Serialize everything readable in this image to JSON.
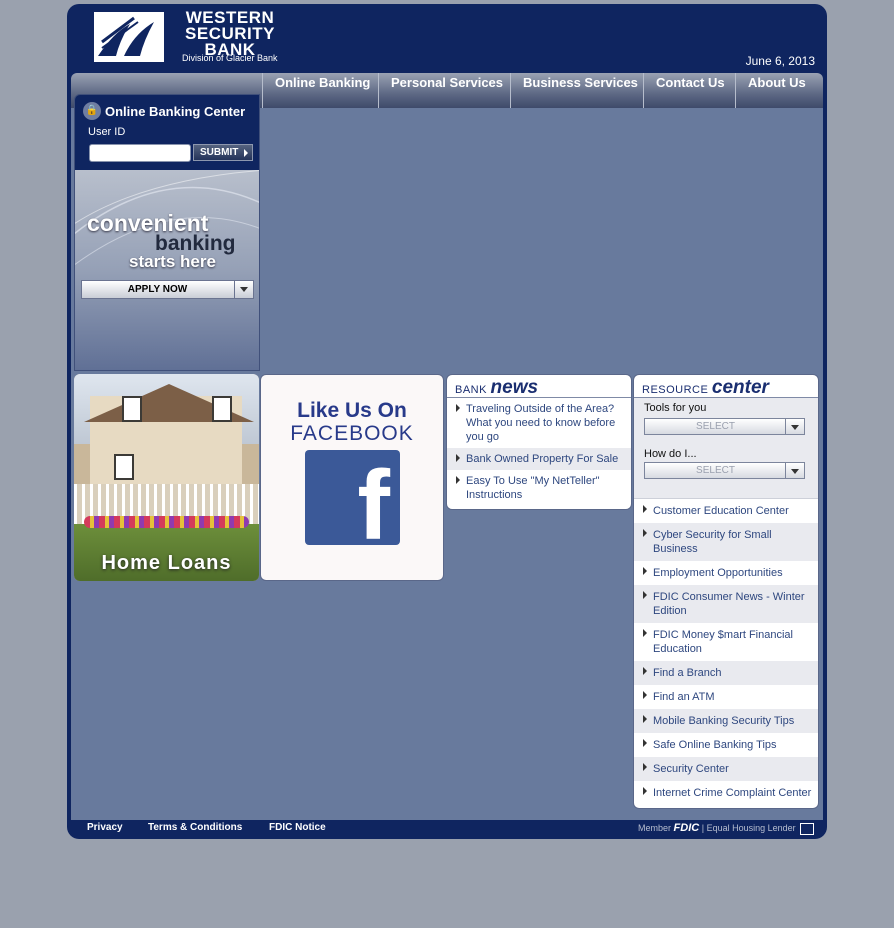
{
  "brand": {
    "name_line1": "WESTERN",
    "name_line2": "SECURITY",
    "name_line3": "BANK",
    "division": "Division of Glacier Bank"
  },
  "date": "June 6, 2013",
  "nav": [
    "Online Banking",
    "Personal Services",
    "Business Services",
    "Contact Us",
    "About Us"
  ],
  "login": {
    "title": "Online Banking Center",
    "user_label": "User ID",
    "user_value": "",
    "submit_label": "SUBMIT"
  },
  "promo": {
    "line1": "convenient",
    "line2": "banking",
    "line3": "starts here",
    "apply_label": "APPLY NOW"
  },
  "home_loans": {
    "label": "Home Loans"
  },
  "facebook": {
    "line1": "Like Us On",
    "line2": "FACEBOOK",
    "icon_letter": "f"
  },
  "bank_news": {
    "title_prefix": "BANK",
    "title_main": "news",
    "items": [
      "Traveling Outside of the Area? What you need to know before you go",
      "Bank Owned Property For Sale",
      "Easy To Use \"My NetTeller\" Instructions"
    ]
  },
  "resource_center": {
    "title_prefix": "RESOURCE",
    "title_main": "center",
    "tools_label": "Tools for you",
    "tools_select": "SELECT",
    "howdo_label": "How do I...",
    "howdo_select": "SELECT",
    "items": [
      "Customer Education Center",
      "Cyber Security for Small Business",
      "Employment Opportunities",
      "FDIC Consumer News - Winter Edition",
      "FDIC Money $mart Financial Education",
      "Find a Branch",
      "Find an ATM",
      "Mobile Banking Security Tips",
      "Safe Online Banking Tips",
      "Security Center",
      "Internet Crime Complaint Center"
    ]
  },
  "footer": {
    "links": [
      "Privacy",
      "Terms & Conditions",
      "FDIC Notice"
    ],
    "member_label": "Member",
    "fdic_label": "FDIC",
    "separator": "|",
    "ehl_label": "Equal Housing Lender"
  }
}
